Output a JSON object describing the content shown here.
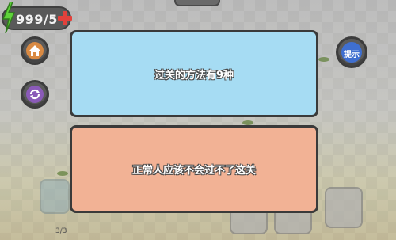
{
  "hud": {
    "energy_text": "999/5"
  },
  "buttons": {
    "home_icon": "home-icon",
    "refresh_icon": "refresh-icon",
    "hint_label": "提示"
  },
  "answers": [
    {
      "label": "过关的方法有9种",
      "color": "#a6dcf3"
    },
    {
      "label": "正常人应该不会过不了这关",
      "color": "#f2b295"
    }
  ],
  "footer": {
    "page_count": "3/3"
  }
}
